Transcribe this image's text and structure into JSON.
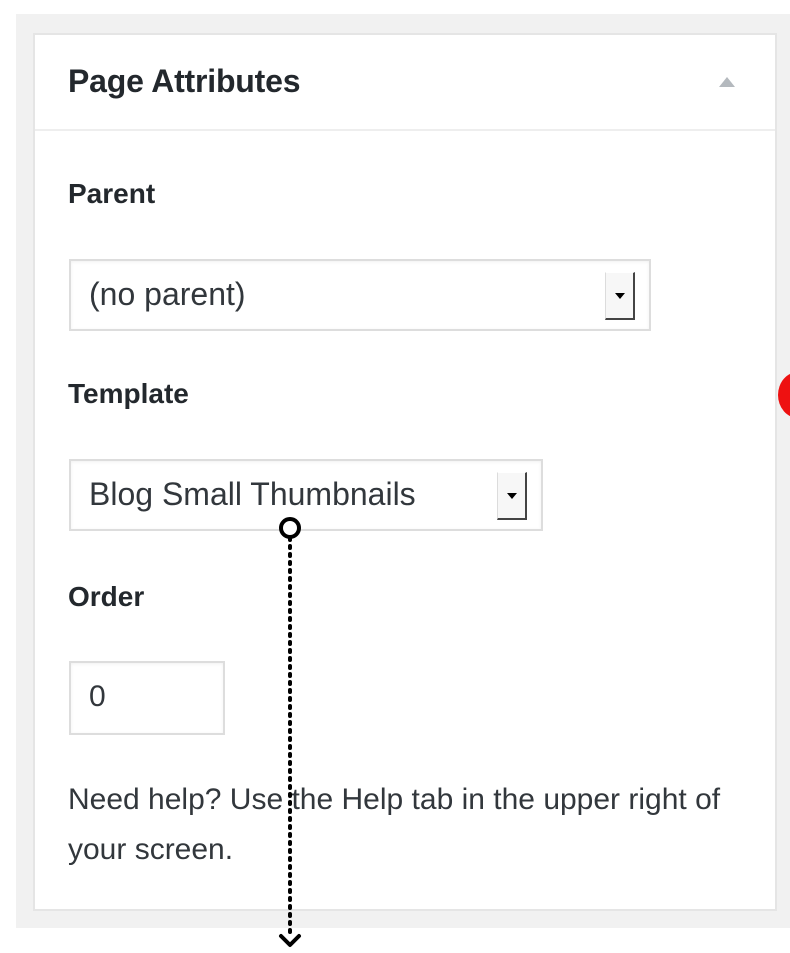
{
  "metabox": {
    "title": "Page Attributes",
    "toggle_icon": "triangle-up-icon"
  },
  "parent": {
    "label": "Parent",
    "selected": "(no parent)"
  },
  "template": {
    "label": "Template",
    "selected": "Blog Small Thumbnails"
  },
  "order": {
    "label": "Order",
    "value": "0"
  },
  "help": {
    "text": "Need help? Use the Help tab in the upper right of your screen."
  },
  "colors": {
    "background": "#f1f1f1",
    "panel": "#ffffff",
    "text": "#23282d",
    "annotation_dot": "#ee1111"
  }
}
